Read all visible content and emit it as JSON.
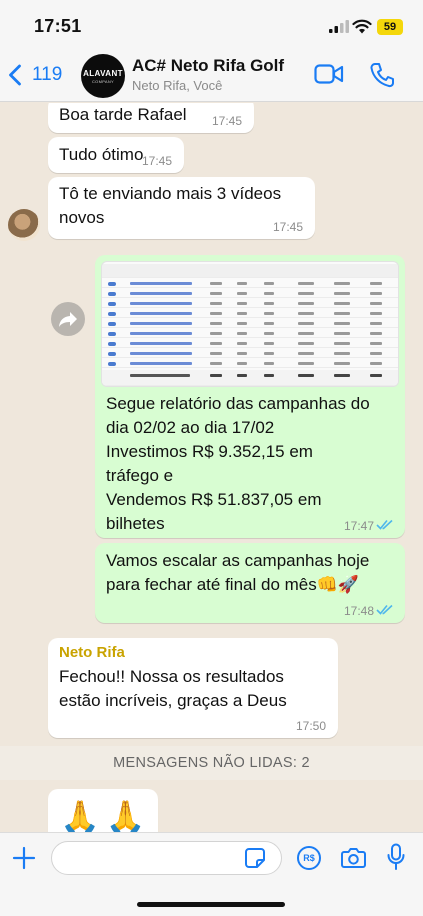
{
  "status_bar": {
    "time": "17:51",
    "battery": "59"
  },
  "header": {
    "back_count": "119",
    "avatar_text": "ALAVANT",
    "avatar_subtext": "COMPANY",
    "title": "AC# Neto Rifa Golf",
    "subtitle": "Neto Rifa, Você"
  },
  "messages": [
    {
      "text": "Boa tarde Rafael",
      "time": "17:45"
    },
    {
      "text": "Tudo ótimo",
      "time": "17:45"
    },
    {
      "text": "Tô te enviando mais 3 vídeos\nnovos",
      "time": "17:45"
    },
    {
      "text": "Segue relatório das campanhas do\ndia 02/02 ao dia 17/02\nInvestimos R$ 9.352,15  em\ntráfego e\nVendemos R$ 51.837,05 em\nbilhetes",
      "time": "17:47"
    },
    {
      "text": "Vamos escalar as campanhas hoje\npara fechar até final do mês👊🚀",
      "time": "17:48"
    },
    {
      "sender": "Neto Rifa",
      "text": "Fechou!! Nossa os resultados\nestão incríveis, graças a Deus",
      "time": "17:50"
    },
    {
      "text": "🙏🙏"
    }
  ],
  "unread_banner": "MENSAGENS NÃO LIDAS: 2",
  "input": {
    "placeholder": ""
  },
  "colors": {
    "accent": "#1a7cf4",
    "outgoing": "#d8fdd2",
    "incoming": "#ffffff",
    "sender_name": "#c9a300",
    "read_ticks": "#4fb6ec"
  },
  "icons": [
    "back-chevron-icon",
    "video-call-icon",
    "phone-icon",
    "forward-icon",
    "read-ticks-icon",
    "plus-icon",
    "sticker-icon",
    "payment-icon",
    "camera-icon",
    "microphone-icon"
  ]
}
